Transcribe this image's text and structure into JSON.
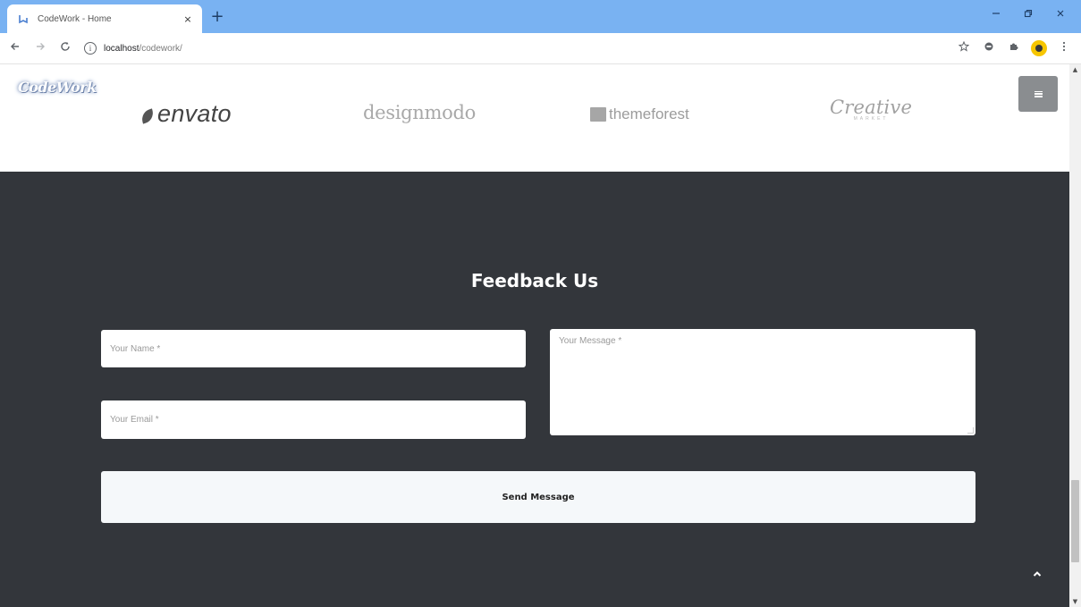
{
  "browser": {
    "tab_title": "CodeWork - Home",
    "tab_close_glyph": "×",
    "new_tab_glyph": "+",
    "url_host": "localhost",
    "url_path": "/codework/",
    "icons": {
      "favicon": "codework-favicon-icon",
      "back": "arrow-left-icon",
      "forward": "arrow-right-icon",
      "reload": "reload-icon",
      "info": "info-icon",
      "bookmark": "star-icon",
      "extension": "extension-icon",
      "puzzle": "puzzle-icon",
      "profile": "profile-avatar-icon",
      "menu": "kebab-menu-icon"
    },
    "colors": {
      "titlebar": "#79b2f2",
      "profile": "#f7c600"
    }
  },
  "site": {
    "logo_text": "CodeWork",
    "brands": {
      "envato": "envato",
      "designmodo": "designmodo",
      "themeforest": "themeforest",
      "creative": "Creative",
      "creative_sub": "MARKET"
    }
  },
  "feedback": {
    "title": "Feedback Us",
    "name_placeholder": "Your Name *",
    "email_placeholder": "Your Email *",
    "message_placeholder": "Your Message *",
    "send_label": "Send Message",
    "colors": {
      "section_bg": "#33363b",
      "button_bg": "#f5f8fa"
    }
  }
}
